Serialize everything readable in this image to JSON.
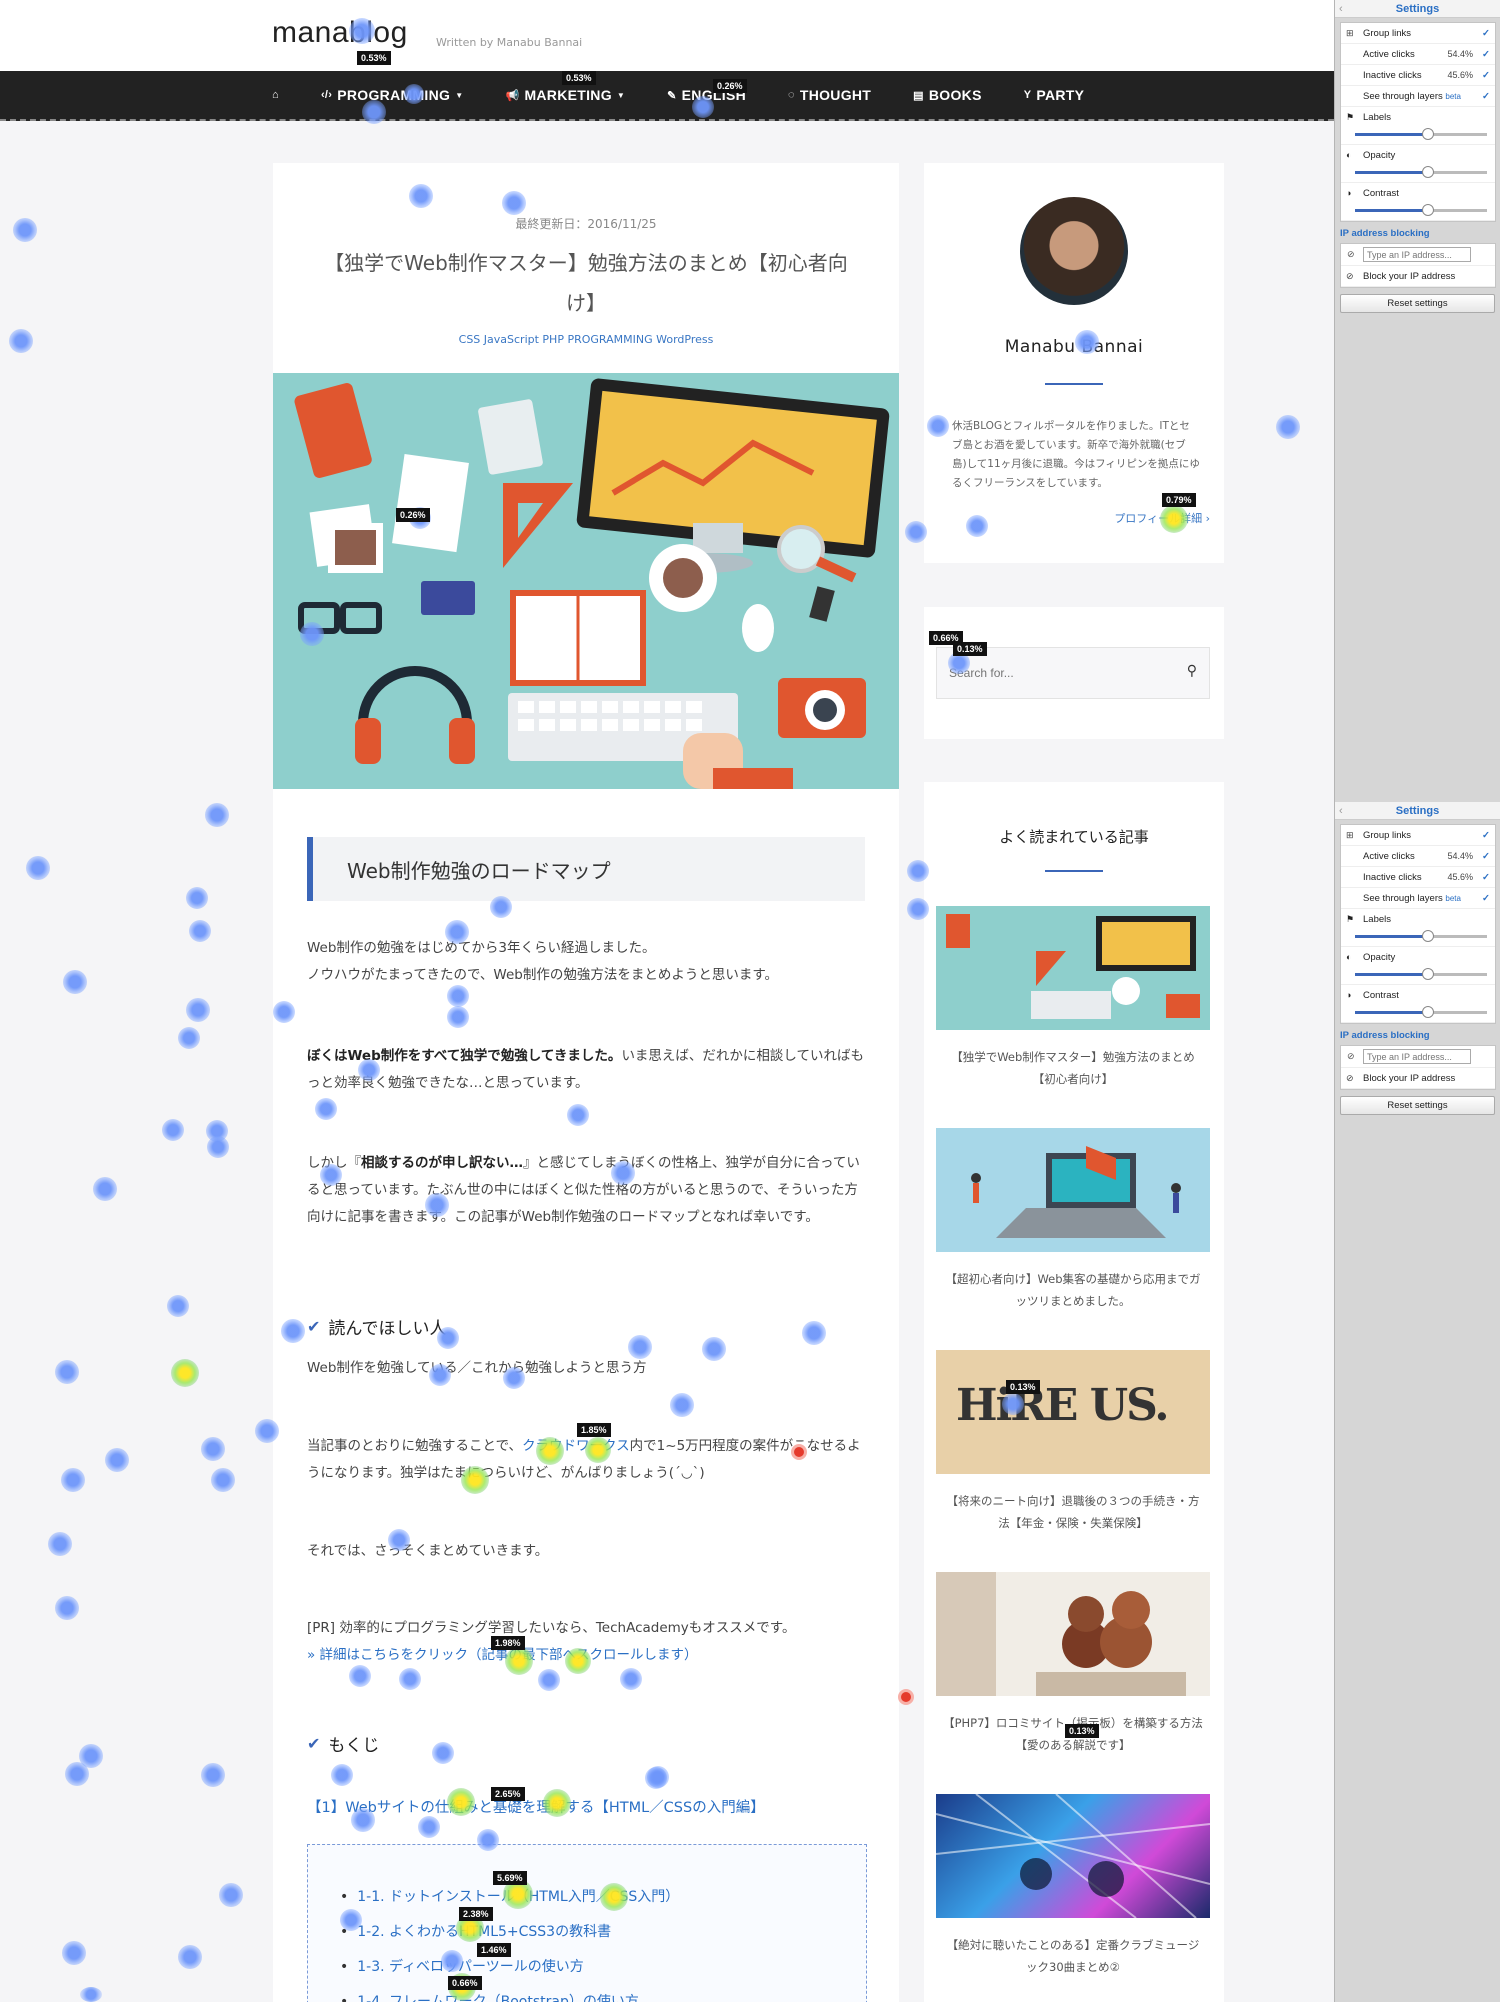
{
  "header": {
    "logo": "manablog",
    "tagline": "Written by Manabu Bannai",
    "nav": [
      {
        "icon": "home-icon",
        "glyph": "⌂",
        "label": ""
      },
      {
        "icon": "code-icon",
        "glyph": "‹/›",
        "label": "PROGRAMMING",
        "dropdown": true
      },
      {
        "icon": "megaphone-icon",
        "glyph": "📢",
        "label": "MARKETING",
        "dropdown": true
      },
      {
        "icon": "pencil-icon",
        "glyph": "✎",
        "label": "ENGLISH"
      },
      {
        "icon": "spinner-icon",
        "glyph": "◌",
        "label": "THOUGHT"
      },
      {
        "icon": "book-icon",
        "glyph": "▤",
        "label": "BOOKS"
      },
      {
        "icon": "cocktail-icon",
        "glyph": "Y",
        "label": "PARTY"
      }
    ]
  },
  "article": {
    "updated": "最終更新日：2016/11/25",
    "title": "【独学でWeb制作マスター】勉強方法のまとめ【初心者向け】",
    "tags": "CSS JavaScript PHP PROGRAMMING WordPress",
    "h2": "Web制作勉強のロードマップ",
    "p1a": "Web制作の勉強をはじめてから3年くらい経過しました。",
    "p1b": "ノウハウがたまってきたので、Web制作の勉強方法をまとめようと思います。",
    "p2_bold": "ぼくはWeb制作をすべて独学で勉強してきました。",
    "p2_rest": "いま思えば、だれかに相談していればもっと効率良く勉強できたな…と思っています。",
    "p3_pre": "しかし『",
    "p3_bold": "相談するのが申し訳ない…",
    "p3_rest": "』と感じてしまうぼくの性格上、独学が自分に合っていると思っています。たぶん世の中にはぼくと似た性格の方がいると思うので、そういった方向けに記事を書きます。この記事がWeb制作勉強のロードマップとなれば幸いです。",
    "h3_readers": "読んでほしい人",
    "readers_text": "Web制作を勉強している／これから勉強しようと思う方",
    "p4_pre": "当記事のとおりに勉強することで、",
    "p4_link": "クラウドワークス",
    "p4_rest": "内で1~5万円程度の案件がこなせるようになります。独学はたまにつらいけど、がんばりましょう(´◡`)",
    "p5": "それでは、さっそくまとめていきます。",
    "pr_text": "[PR] 効率的にプログラミング学習したいなら、TechAcademyもオススメです。",
    "pr_link": "» 詳細はこちらをクリック（記事の最下部へスクロールします）",
    "h3_toc": "もくじ",
    "toc_head": "【1】Webサイトの仕組みと基礎を理解する【HTML／CSSの入門編】",
    "toc_items": [
      "1-1. ドットインストール（HTML入門／CSS入門）",
      "1-2. よくわかるHTML5+CSS3の教科書",
      "1-3. ディベロッパーツールの使い方",
      "1-4. フレームワーク（Bootstrap）の使い方"
    ]
  },
  "sidebar": {
    "profile_name": "Manabu Bannai",
    "profile_bio": "休活BLOGとフィルポータルを作りました。ITとセブ島とお酒を愛しています。新卒で海外就職(セブ島)して11ヶ月後に退職。今はフィリピンを拠点にゆるくフリーランスをしています。",
    "profile_more": "プロフィール詳細 ›",
    "search_placeholder": "Search for...",
    "popular_title": "よく読まれている記事",
    "posts": [
      {
        "caption": "【独学でWeb制作マスター】勉強方法のまとめ【初心者向け】"
      },
      {
        "caption": "【超初心者向け】Web集客の基礎から応用までガッツリまとめました。"
      },
      {
        "caption": "【将来のニート向け】退職後の３つの手続き・方法【年金・保険・失業保険】",
        "thumb_text": "HiRE US."
      },
      {
        "caption": "【PHP7】ロコミサイト（掲示板）を構築する方法【愛のある解説です】"
      },
      {
        "caption": "【絶対に聴いたことのある】定番クラブミュージック30曲まとめ②"
      }
    ]
  },
  "heatmap": {
    "badges": [
      "0.53%",
      "0.53%",
      "0.26%",
      "0.26%",
      "0.79%",
      "0.66%",
      "0.13%",
      "1.85%",
      "0.13%",
      "1.98%",
      "0.13%",
      "2.65%",
      "5.69%",
      "2.38%",
      "1.46%",
      "0.66%"
    ]
  },
  "settings": {
    "title": "Settings",
    "group_links": "Group links",
    "active_clicks": "Active clicks",
    "active_pct": "54.4%",
    "inactive_clicks": "Inactive clicks",
    "inactive_pct": "45.6%",
    "see_through": "See through layers",
    "beta": "beta",
    "labels": "Labels",
    "opacity": "Opacity",
    "contrast": "Contrast",
    "labels_level": 0.55,
    "opacity_level": 0.55,
    "contrast_level": 0.55,
    "ip_heading": "IP address blocking",
    "ip_placeholder": "Type an IP address...",
    "block_own": "Block your IP address",
    "reset": "Reset settings"
  }
}
